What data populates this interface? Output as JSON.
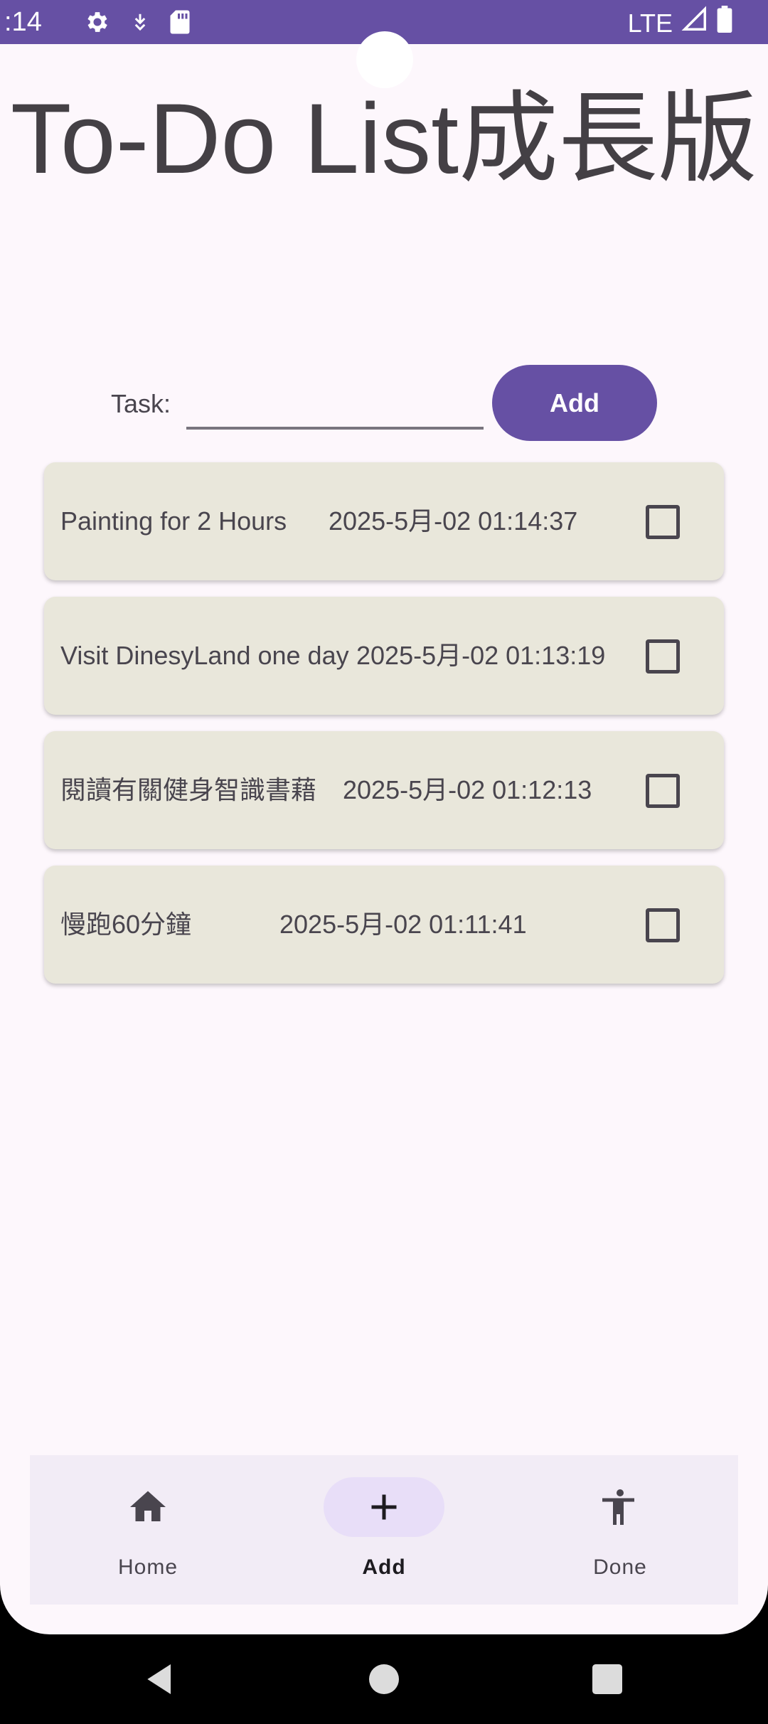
{
  "status_bar": {
    "time": ":14",
    "network": "LTE",
    "icons": [
      "settings-icon",
      "download-icon",
      "sd-card-icon",
      "signal-icon",
      "battery-icon"
    ],
    "background": "#6650a4"
  },
  "app": {
    "title": "To-Do List成長版"
  },
  "input_row": {
    "label": "Task:",
    "value": "",
    "add_label": "Add"
  },
  "tasks": [
    {
      "name": "Painting for 2 Hours",
      "time": "2025-5月-02 01:14:37",
      "checked": false
    },
    {
      "name": "Visit DinesyLand one day",
      "time": "2025-5月-02 01:13:19",
      "checked": false
    },
    {
      "name": "閱讀有關健身智識書藉",
      "time": "2025-5月-02 01:12:13",
      "checked": false
    },
    {
      "name": "慢跑60分鐘",
      "time": "2025-5月-02 01:11:41",
      "checked": false
    }
  ],
  "bottom_nav": {
    "items": [
      {
        "label": "Home",
        "icon": "home-icon",
        "active": false
      },
      {
        "label": "Add",
        "icon": "plus-icon",
        "active": true
      },
      {
        "label": "Done",
        "icon": "accessibility-icon",
        "active": false
      }
    ]
  },
  "colors": {
    "primary": "#6650a4",
    "card": "#e9e7db",
    "surface": "#fdf7fc",
    "nav_bar": "#f2ecf6",
    "active_indicator": "#e8def8"
  }
}
